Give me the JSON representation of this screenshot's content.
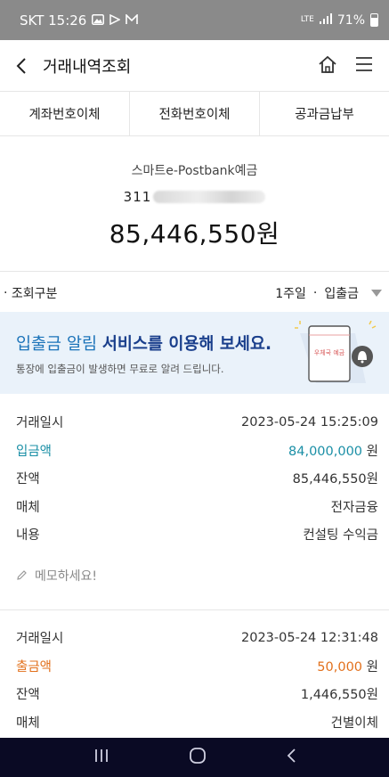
{
  "status_bar": {
    "carrier_time": "SKT 15:26",
    "network": "LTE",
    "battery": "71%"
  },
  "header": {
    "title": "거래내역조회"
  },
  "tabs": [
    {
      "label": "계좌번호이체"
    },
    {
      "label": "전화번호이체"
    },
    {
      "label": "공과금납부"
    }
  ],
  "account": {
    "name": "스마트e-Postbank예금",
    "number_visible": "311",
    "balance": "85,446,550원"
  },
  "filter": {
    "label": "조회구분",
    "period": "1주일",
    "type": "입출금"
  },
  "banner": {
    "title_part1": "입출금 알림 ",
    "title_part2": "서비스를 이용해 보세요.",
    "subtitle": "통장에 입출금이 발생하면 무료로 알려 드립니다.",
    "card_label": "우체국 예금"
  },
  "transactions": [
    {
      "date_label": "거래일시",
      "date": "2023-05-24 15:25:09",
      "amount_label": "입금액",
      "amount": "84,000,000",
      "amount_unit": "원",
      "balance_label": "잔액",
      "balance": "85,446,550원",
      "channel_label": "매체",
      "channel": "전자금융",
      "content_label": "내용",
      "content": "컨설팅 수익금",
      "memo_placeholder": "메모하세요!"
    },
    {
      "date_label": "거래일시",
      "date": "2023-05-24 12:31:48",
      "amount_label": "출금액",
      "amount": "50,000",
      "amount_unit": "원",
      "balance_label": "잔액",
      "balance": "1,446,550원",
      "channel_label": "매체",
      "channel": "건별이체"
    }
  ],
  "colors": {
    "deposit": "#1a8fa6",
    "withdraw": "#e2701c",
    "banner_bg": "#eaf2fa",
    "navbar": "#0a0a24"
  }
}
